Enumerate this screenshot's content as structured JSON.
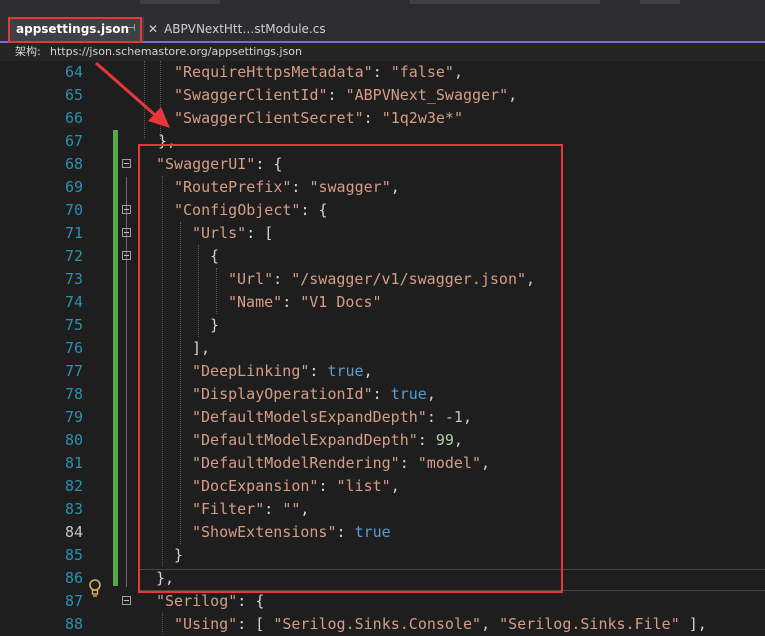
{
  "tabs": [
    {
      "label": "appsettings.json",
      "pin_glyph": "⊣",
      "active": true
    },
    {
      "label": "ABPVNextHtt…stModule.cs",
      "close_glyph": "✕",
      "active": false
    }
  ],
  "schema": {
    "label": "架构:",
    "url": "https://json.schemastore.org/appsettings.json"
  },
  "lines": [
    {
      "n": "64",
      "tokens": [
        [
          "k",
          "\"RequireHttpsMetadata\""
        ],
        [
          "p",
          ": "
        ],
        [
          "s",
          "\"false\""
        ],
        [
          "p",
          ","
        ]
      ]
    },
    {
      "n": "65",
      "tokens": [
        [
          "k",
          "\"SwaggerClientId\""
        ],
        [
          "p",
          ": "
        ],
        [
          "s",
          "\"ABPVNext_Swagger\""
        ],
        [
          "p",
          ","
        ]
      ]
    },
    {
      "n": "66",
      "tokens": [
        [
          "k",
          "\"SwaggerClientSecret\""
        ],
        [
          "p",
          ": "
        ],
        [
          "s",
          "\"1q2w3e*\""
        ]
      ]
    },
    {
      "n": "67",
      "tokens": [
        [
          "p",
          "},"
        ]
      ]
    },
    {
      "n": "68",
      "tokens": [
        [
          "k",
          "\"SwaggerUI\""
        ],
        [
          "p",
          ": {"
        ]
      ]
    },
    {
      "n": "69",
      "tokens": [
        [
          "k",
          "\"RoutePrefix\""
        ],
        [
          "p",
          ": "
        ],
        [
          "s",
          "\"swagger\""
        ],
        [
          "p",
          ","
        ]
      ]
    },
    {
      "n": "70",
      "tokens": [
        [
          "k",
          "\"ConfigObject\""
        ],
        [
          "p",
          ": {"
        ]
      ]
    },
    {
      "n": "71",
      "tokens": [
        [
          "k",
          "\"Urls\""
        ],
        [
          "p",
          ": ["
        ]
      ]
    },
    {
      "n": "72",
      "tokens": [
        [
          "p",
          "{"
        ]
      ]
    },
    {
      "n": "73",
      "tokens": [
        [
          "k",
          "\"Url\""
        ],
        [
          "p",
          ": "
        ],
        [
          "s",
          "\"/swagger/v1/swagger.json\""
        ],
        [
          "p",
          ","
        ]
      ]
    },
    {
      "n": "74",
      "tokens": [
        [
          "k",
          "\"Name\""
        ],
        [
          "p",
          ": "
        ],
        [
          "s",
          "\"V1 Docs\""
        ]
      ]
    },
    {
      "n": "75",
      "tokens": [
        [
          "p",
          "}"
        ]
      ]
    },
    {
      "n": "76",
      "tokens": [
        [
          "p",
          "],"
        ]
      ]
    },
    {
      "n": "77",
      "tokens": [
        [
          "k",
          "\"DeepLinking\""
        ],
        [
          "p",
          ": "
        ],
        [
          "kw",
          "true"
        ],
        [
          "p",
          ","
        ]
      ]
    },
    {
      "n": "78",
      "tokens": [
        [
          "k",
          "\"DisplayOperationId\""
        ],
        [
          "p",
          ": "
        ],
        [
          "kw",
          "true"
        ],
        [
          "p",
          ","
        ]
      ]
    },
    {
      "n": "79",
      "tokens": [
        [
          "k",
          "\"DefaultModelsExpandDepth\""
        ],
        [
          "p",
          ": "
        ],
        [
          "n",
          "-1"
        ],
        [
          "p",
          ","
        ]
      ]
    },
    {
      "n": "80",
      "tokens": [
        [
          "k",
          "\"DefaultModelExpandDepth\""
        ],
        [
          "p",
          ": "
        ],
        [
          "n",
          "99"
        ],
        [
          "p",
          ","
        ]
      ]
    },
    {
      "n": "81",
      "tokens": [
        [
          "k",
          "\"DefaultModelRendering\""
        ],
        [
          "p",
          ": "
        ],
        [
          "s",
          "\"model\""
        ],
        [
          "p",
          ","
        ]
      ]
    },
    {
      "n": "82",
      "tokens": [
        [
          "k",
          "\"DocExpansion\""
        ],
        [
          "p",
          ": "
        ],
        [
          "s",
          "\"list\""
        ],
        [
          "p",
          ","
        ]
      ]
    },
    {
      "n": "83",
      "tokens": [
        [
          "k",
          "\"Filter\""
        ],
        [
          "p",
          ": "
        ],
        [
          "s",
          "\"\""
        ],
        [
          "p",
          ","
        ]
      ]
    },
    {
      "n": "84",
      "tokens": [
        [
          "k",
          "\"ShowExtensions\""
        ],
        [
          "p",
          ": "
        ],
        [
          "kw",
          "true"
        ]
      ]
    },
    {
      "n": "85",
      "tokens": [
        [
          "p",
          "}"
        ]
      ]
    },
    {
      "n": "86",
      "tokens": [
        [
          "p",
          "},"
        ]
      ]
    },
    {
      "n": "87",
      "tokens": [
        [
          "k",
          "\"Serilog\""
        ],
        [
          "p",
          ": {"
        ]
      ]
    },
    {
      "n": "88",
      "tokens": [
        [
          "k",
          "\"Using\""
        ],
        [
          "p",
          ": [ "
        ],
        [
          "s",
          "\"Serilog.Sinks.Console\""
        ],
        [
          "p",
          ", "
        ],
        [
          "s",
          "\"Serilog.Sinks.File\""
        ],
        [
          "p",
          " ],"
        ]
      ]
    }
  ],
  "current_line": "84",
  "colors": {
    "key": "#d69d85",
    "keyword": "#569cd6",
    "number": "#b5cea8",
    "line_number": "#2b91af",
    "annotation": "#e8373a",
    "changed_bar": "#57a64a"
  }
}
